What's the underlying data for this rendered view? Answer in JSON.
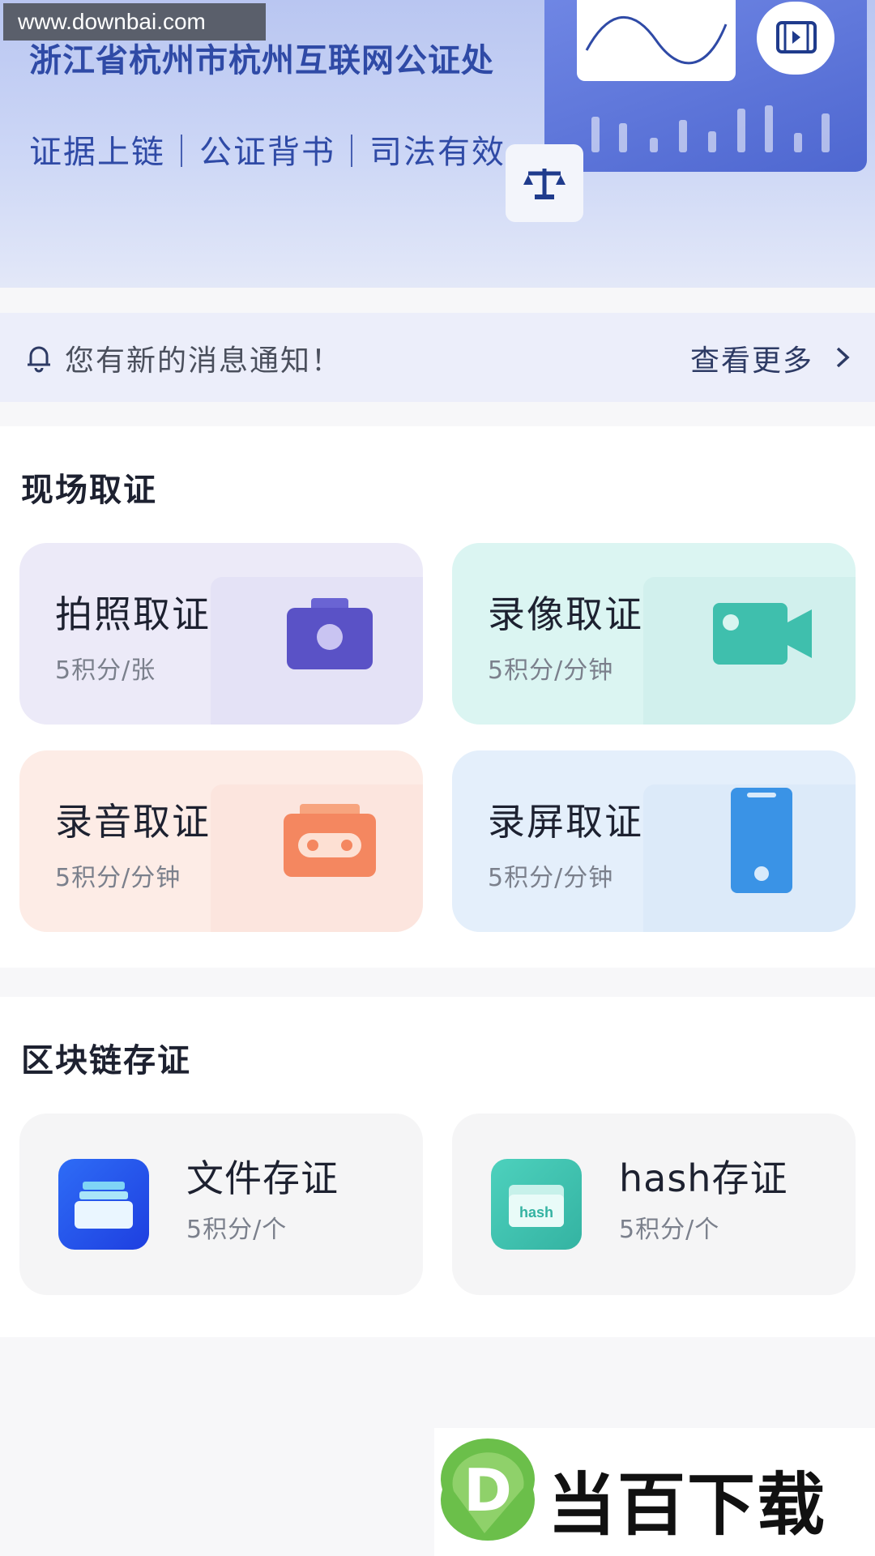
{
  "watermark": "www.downbai.com",
  "banner": {
    "title": "浙江省杭州市杭州互联网公证处",
    "subtitle": "证据上链｜公证背书｜司法有效"
  },
  "notice": {
    "text": "您有新的消息通知！",
    "more": "查看更多"
  },
  "sections": {
    "onsite": {
      "title": "现场取证",
      "cards": [
        {
          "title": "拍照取证",
          "price": "5积分/张",
          "color": "#5e58c9",
          "icon": "camera-icon"
        },
        {
          "title": "录像取证",
          "price": "5积分/分钟",
          "color": "#3fc3b0",
          "icon": "video-camera-icon"
        },
        {
          "title": "录音取证",
          "price": "5积分/分钟",
          "color": "#f58a62",
          "icon": "cassette-icon"
        },
        {
          "title": "录屏取证",
          "price": "5积分/分钟",
          "color": "#3a93e6",
          "icon": "phone-icon"
        }
      ]
    },
    "blockchain": {
      "title": "区块链存证",
      "cards": [
        {
          "title": "文件存证",
          "price": "5积分/个",
          "color": "#2d55f0",
          "icon": "file-box-icon"
        },
        {
          "title": "hash存证",
          "price": "5积分/个",
          "color": "#3fc3b0",
          "icon": "hash-folder-icon",
          "icon_label": "hash"
        }
      ]
    }
  },
  "brand": {
    "name": "当百下载",
    "letter": "D"
  }
}
